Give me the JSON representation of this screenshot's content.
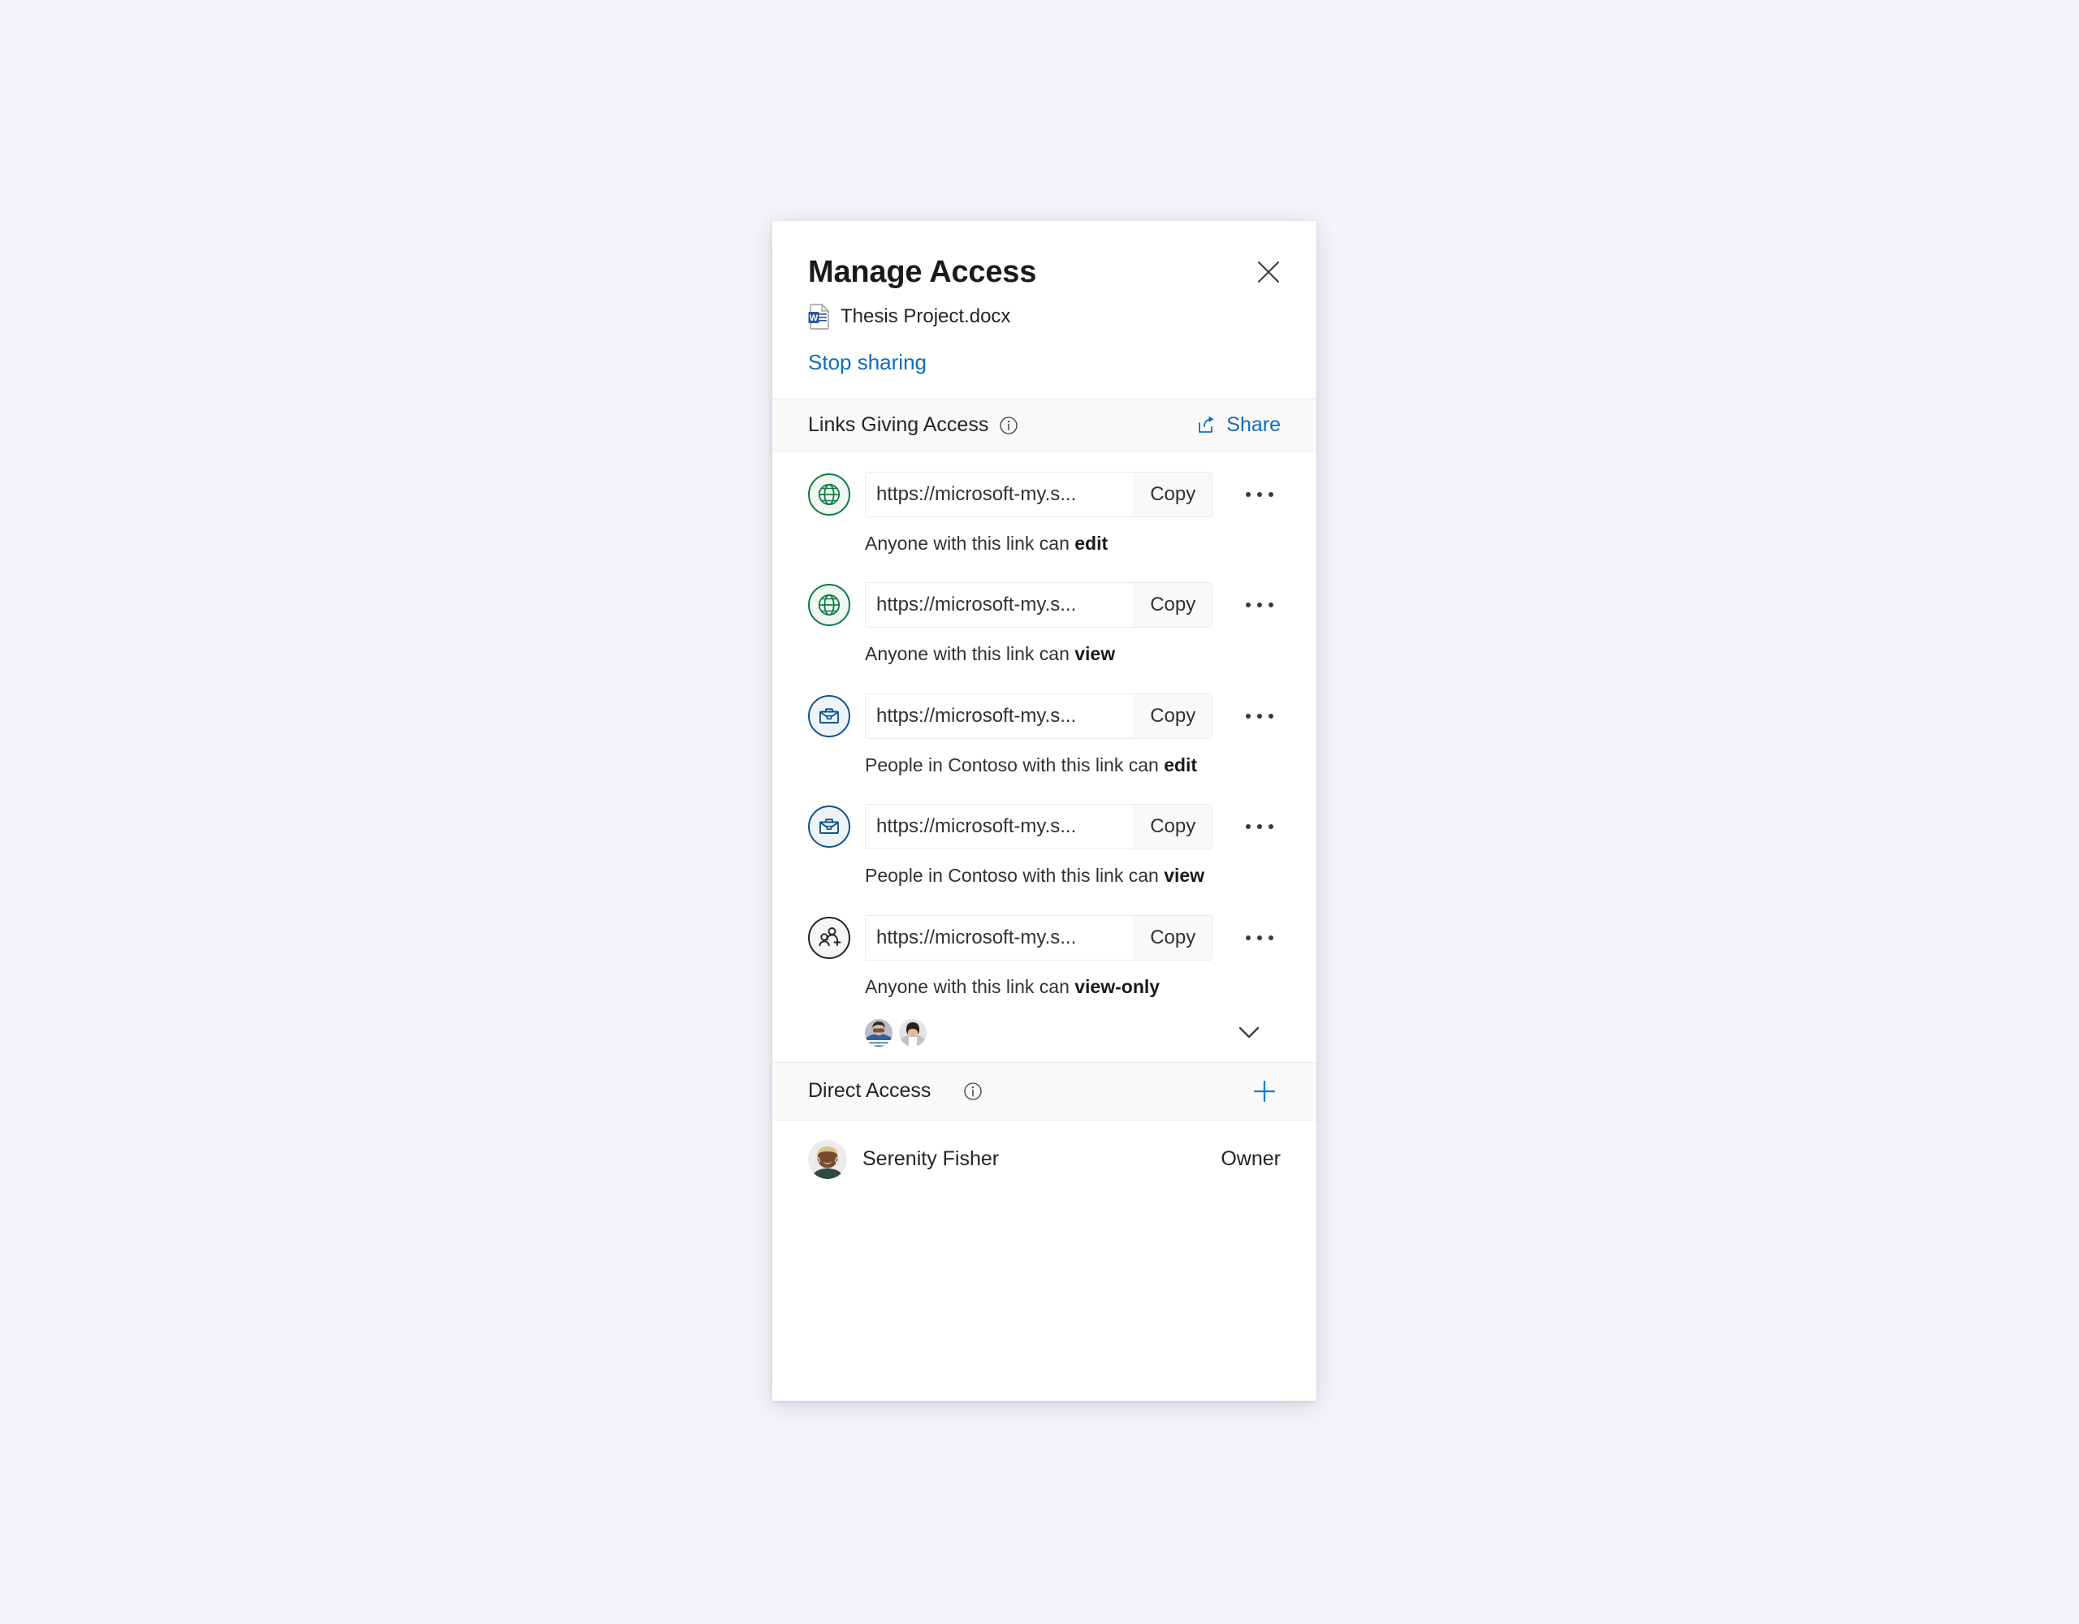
{
  "panel": {
    "title": "Manage Access",
    "close_label": "Close",
    "file_name": "Thesis Project.docx",
    "file_icon": "word-document-icon",
    "stop_sharing_label": "Stop sharing"
  },
  "links_section": {
    "title": "Links Giving Access",
    "info_icon": "info-icon",
    "share_label": "Share",
    "share_icon": "share-icon",
    "rows": [
      {
        "icon": "globe-icon",
        "url": "https://microsoft-my.s...",
        "copy_label": "Copy",
        "more_label": "More options",
        "desc_prefix": "Anyone with this link can ",
        "desc_emphasis": "edit"
      },
      {
        "icon": "globe-icon",
        "url": "https://microsoft-my.s...",
        "copy_label": "Copy",
        "more_label": "More options",
        "desc_prefix": "Anyone with this link can ",
        "desc_emphasis": "view"
      },
      {
        "icon": "briefcase-icon",
        "url": "https://microsoft-my.s...",
        "copy_label": "Copy",
        "more_label": "More options",
        "desc_prefix": "People in Contoso with this link can ",
        "desc_emphasis": "edit"
      },
      {
        "icon": "briefcase-icon",
        "url": "https://microsoft-my.s...",
        "copy_label": "Copy",
        "more_label": "More options",
        "desc_prefix": "People in Contoso with this link can ",
        "desc_emphasis": "view"
      },
      {
        "icon": "people-add-icon",
        "url": "https://microsoft-my.s...",
        "copy_label": "Copy",
        "more_label": "More options",
        "desc_prefix": "Anyone with this link can ",
        "desc_emphasis": "view-only",
        "avatars": 2,
        "expand_icon": "chevron-down-icon"
      }
    ]
  },
  "direct_section": {
    "title": "Direct Access",
    "info_icon": "info-icon",
    "add_icon": "plus-icon",
    "people": [
      {
        "name": "Serenity Fisher",
        "role": "Owner"
      }
    ]
  },
  "colors": {
    "page_background": "#f4f4f9",
    "panel_background": "#ffffff",
    "accent_link": "#0f6cbd",
    "section_header_background": "#faf9f8",
    "globe_green": "#107c41",
    "briefcase_blue": "#0f548c",
    "text_primary": "#242424"
  }
}
